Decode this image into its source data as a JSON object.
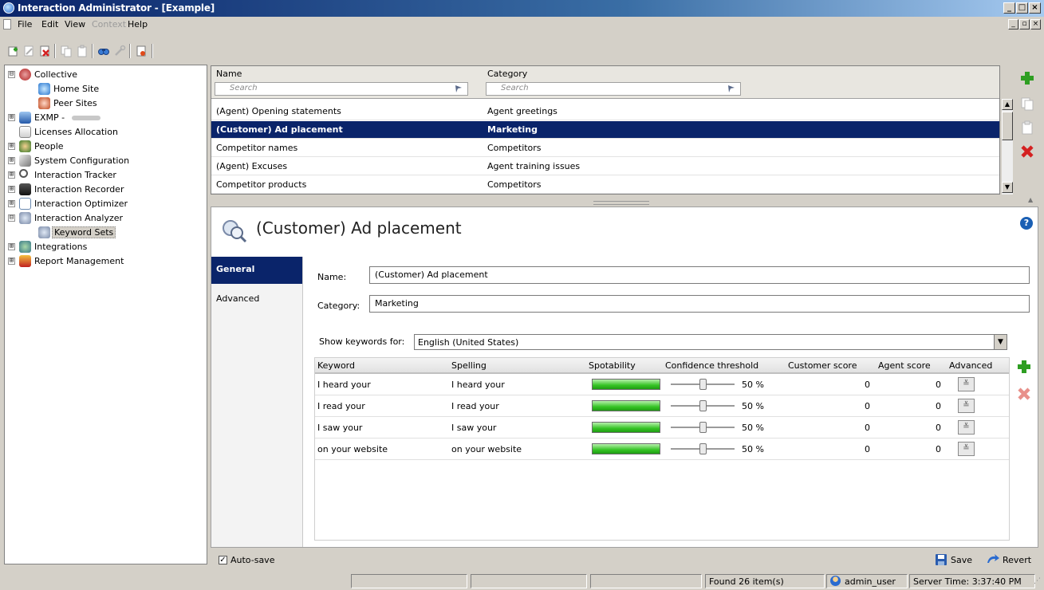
{
  "window": {
    "title": "Interaction Administrator - [Example]",
    "caption_buttons": [
      "_",
      "□",
      "×"
    ]
  },
  "menu": {
    "items": [
      {
        "label": "File",
        "enabled": true
      },
      {
        "label": "Edit",
        "enabled": true
      },
      {
        "label": "View",
        "enabled": true
      },
      {
        "label": "Context",
        "enabled": false
      },
      {
        "label": "Help",
        "enabled": true
      }
    ],
    "mdi_buttons": [
      "_",
      "▫",
      "×"
    ]
  },
  "toolbar": {
    "icons": [
      "new-icon",
      "edit-icon",
      "delete-icon",
      "copy-icon",
      "paste-icon",
      "find-icon",
      "properties-icon",
      "report-icon"
    ]
  },
  "tree": {
    "items": [
      {
        "label": "Collective",
        "expander": "⊟",
        "icon": "collective-icon"
      },
      {
        "label": "Home Site",
        "expander": "",
        "icon": "home-site-icon"
      },
      {
        "label": "Peer Sites",
        "expander": "",
        "icon": "peer-sites-icon"
      },
      {
        "label": "EXMP -",
        "expander": "⊞",
        "icon": "server-icon"
      },
      {
        "label": "Licenses Allocation",
        "expander": "",
        "icon": "license-icon"
      },
      {
        "label": "People",
        "expander": "⊞",
        "icon": "people-icon"
      },
      {
        "label": "System Configuration",
        "expander": "⊞",
        "icon": "configuration-icon"
      },
      {
        "label": "Interaction Tracker",
        "expander": "⊞",
        "icon": "tracker-icon"
      },
      {
        "label": "Interaction Recorder",
        "expander": "⊞",
        "icon": "recorder-icon"
      },
      {
        "label": "Interaction Optimizer",
        "expander": "⊞",
        "icon": "optimizer-icon"
      },
      {
        "label": "Interaction Analyzer",
        "expander": "⊟",
        "icon": "analyzer-icon"
      },
      {
        "label": "Keyword Sets",
        "expander": "",
        "icon": "keyword-sets-icon"
      },
      {
        "label": "Integrations",
        "expander": "⊞",
        "icon": "integrations-icon"
      },
      {
        "label": "Report Management",
        "expander": "⊞",
        "icon": "report-management-icon"
      }
    ]
  },
  "list": {
    "columns": [
      "Name",
      "Category"
    ],
    "search_placeholders": [
      "Search",
      "Search"
    ],
    "rows": [
      {
        "name": "(Agent) Opening statements",
        "category": "Agent greetings"
      },
      {
        "name": "(Customer) Ad placement",
        "category": "Marketing"
      },
      {
        "name": "Competitor names",
        "category": "Competitors"
      },
      {
        "name": "(Agent) Excuses",
        "category": "Agent training issues"
      },
      {
        "name": "Competitor products",
        "category": "Competitors"
      }
    ],
    "selected_index": 1
  },
  "side_actions": [
    "add-icon",
    "copy-icon",
    "paste-icon",
    "delete-icon"
  ],
  "detail": {
    "title": "(Customer) Ad placement",
    "nav": [
      "General",
      "Advanced"
    ],
    "name_label": "Name:",
    "name_value": "(Customer) Ad placement",
    "category_label": "Category:",
    "category_value": "Marketing",
    "show_keywords_label": "Show keywords for:",
    "language": "English (United States)",
    "keyword_columns": [
      "Keyword",
      "Spelling",
      "Spotability",
      "Confidence threshold",
      "Customer score",
      "Agent score",
      "Advanced"
    ],
    "keywords": [
      {
        "keyword": "I heard your",
        "spelling": "I heard your",
        "spotability": 1.0,
        "confidence": 50,
        "confidence_text": "50 %",
        "customer_score": "0",
        "agent_score": "0",
        "advanced": "≚"
      },
      {
        "keyword": "I read your",
        "spelling": "I read your",
        "spotability": 1.0,
        "confidence": 50,
        "confidence_text": "50 %",
        "customer_score": "0",
        "agent_score": "0",
        "advanced": "≚"
      },
      {
        "keyword": "I saw your",
        "spelling": "I saw your",
        "spotability": 1.0,
        "confidence": 50,
        "confidence_text": "50 %",
        "customer_score": "0",
        "agent_score": "0",
        "advanced": "≚"
      },
      {
        "keyword": "on your website",
        "spelling": "on your website",
        "spotability": 1.0,
        "confidence": 50,
        "confidence_text": "50 %",
        "customer_score": "0",
        "agent_score": "0",
        "advanced": "≚"
      }
    ]
  },
  "bottom": {
    "autosave_label": "Auto-save",
    "autosave_checked": true,
    "save_label": "Save",
    "revert_label": "Revert"
  },
  "status": {
    "found": "Found 26 item(s)",
    "user": "admin_user",
    "server_time": "Server Time: 3:37:40 PM"
  },
  "colors": {
    "selection": "#0a246a",
    "add_green": "#2e9e22",
    "delete_red": "#d42020",
    "spot_green": "#36c425"
  }
}
